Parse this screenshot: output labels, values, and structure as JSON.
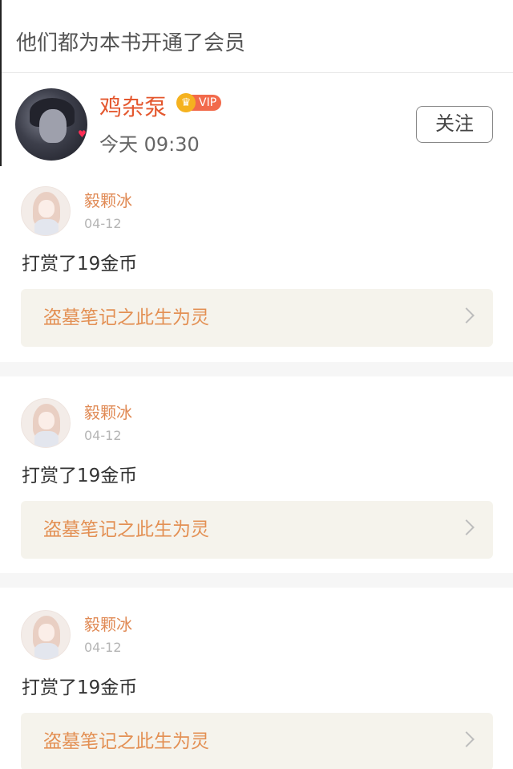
{
  "header": {
    "title": "他们都为本书开通了会员"
  },
  "member": {
    "name": "鸡杂泵",
    "vip_label": "VIP",
    "time": "今天 09:30",
    "follow_label": "关注",
    "avatar_icon": "user-avatar-icon"
  },
  "cards": [
    {
      "name": "毅颗冰",
      "date": "04-12",
      "action": "打赏了19金币",
      "book": "盗墓笔记之此生为灵"
    },
    {
      "name": "毅颗冰",
      "date": "04-12",
      "action": "打赏了19金币",
      "book": "盗墓笔记之此生为灵"
    },
    {
      "name": "毅颗冰",
      "date": "04-12",
      "action": "打赏了19金币",
      "book": "盗墓笔记之此生为灵"
    }
  ],
  "colors": {
    "accent": "#e4572e",
    "book_link_text": "#e39054",
    "book_link_bg": "#f5f3ec",
    "vip_gold": "#f5b21f",
    "vip_red": "#f26a4b"
  }
}
